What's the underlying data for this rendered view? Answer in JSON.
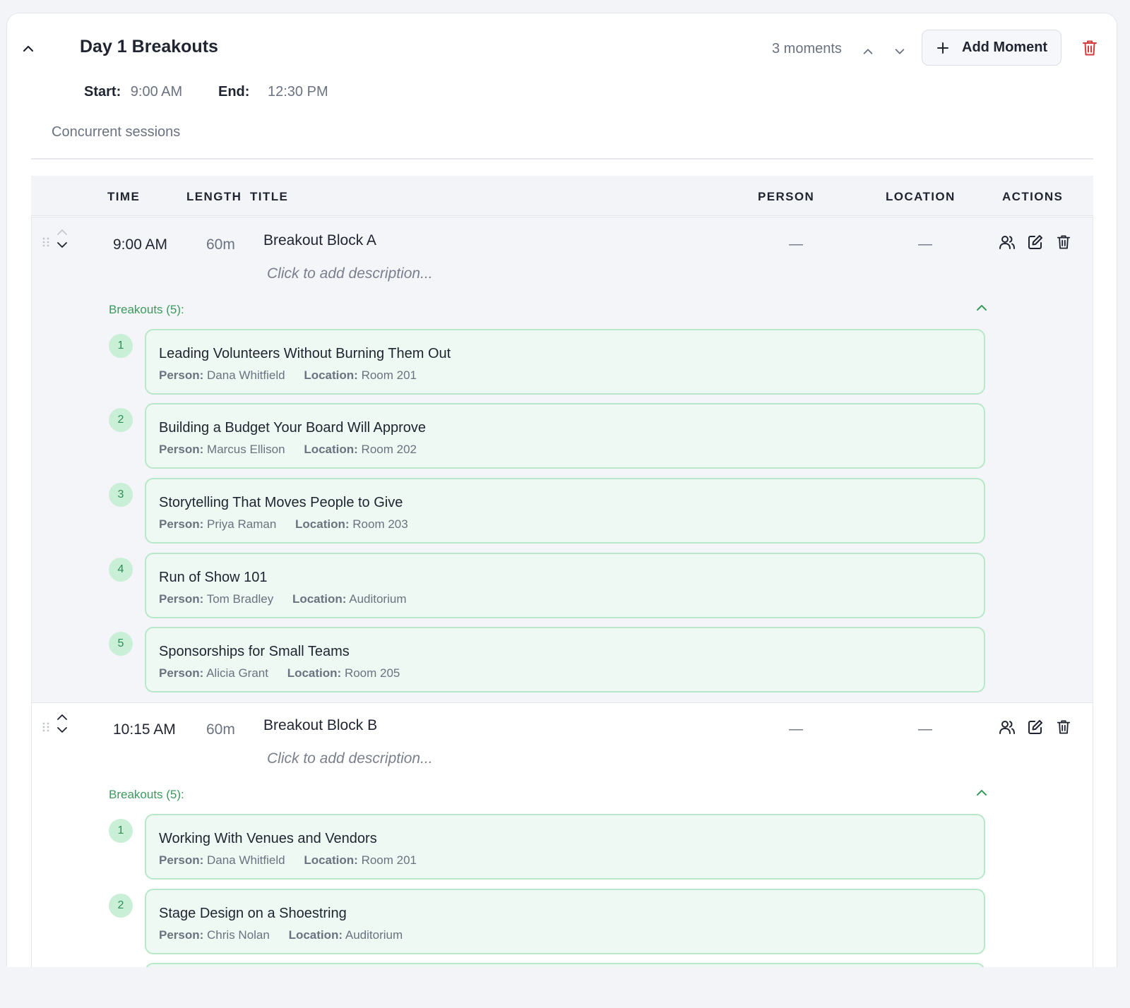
{
  "section": {
    "title": "Day 1 Breakouts",
    "moments_count": "3 moments",
    "add_moment_label": "Add Moment",
    "start_label": "Start:",
    "start_value": "9:00 AM",
    "end_label": "End:",
    "end_value": "12:30 PM",
    "description": "Concurrent sessions"
  },
  "table": {
    "columns": {
      "time": "TIME",
      "length": "LENGTH",
      "title": "TITLE",
      "person": "PERSON",
      "location": "LOCATION",
      "actions": "ACTIONS"
    }
  },
  "moments": [
    {
      "time": "9:00 AM",
      "length": "60m",
      "title": "Breakout Block A",
      "description_placeholder": "Click to add description...",
      "person": "—",
      "location": "—",
      "breakouts_label": "Breakouts (5):",
      "breakouts": [
        {
          "num": "1",
          "title": "Leading Volunteers Without Burning Them Out",
          "person_label": "Person:",
          "person": "Dana Whitfield",
          "location_label": "Location:",
          "location": "Room 201"
        },
        {
          "num": "2",
          "title": "Building a Budget Your Board Will Approve",
          "person_label": "Person:",
          "person": "Marcus Ellison",
          "location_label": "Location:",
          "location": "Room 202"
        },
        {
          "num": "3",
          "title": "Storytelling That Moves People to Give",
          "person_label": "Person:",
          "person": "Priya Raman",
          "location_label": "Location:",
          "location": "Room 203"
        },
        {
          "num": "4",
          "title": "Run of Show 101",
          "person_label": "Person:",
          "person": "Tom Bradley",
          "location_label": "Location:",
          "location": "Auditorium"
        },
        {
          "num": "5",
          "title": "Sponsorships for Small Teams",
          "person_label": "Person:",
          "person": "Alicia Grant",
          "location_label": "Location:",
          "location": "Room 205"
        }
      ]
    },
    {
      "time": "10:15 AM",
      "length": "60m",
      "title": "Breakout Block B",
      "description_placeholder": "Click to add description...",
      "person": "—",
      "location": "—",
      "breakouts_label": "Breakouts (5):",
      "breakouts": [
        {
          "num": "1",
          "title": "Working With Venues and Vendors",
          "person_label": "Person:",
          "person": "Dana Whitfield",
          "location_label": "Location:",
          "location": "Room 201"
        },
        {
          "num": "2",
          "title": "Stage Design on a Shoestring",
          "person_label": "Person:",
          "person": "Chris Nolan",
          "location_label": "Location:",
          "location": "Auditorium"
        }
      ]
    }
  ],
  "colors": {
    "accent_green": "#3a9a5c",
    "breakout_bg": "#edf9f2",
    "breakout_border": "#b8e7c9",
    "danger": "#d63b3b"
  },
  "icons": {
    "collapse": "chevron-up-icon",
    "move_up": "chevron-up-icon",
    "move_down": "chevron-down-icon",
    "add": "plus-icon",
    "delete": "trash-icon",
    "people": "people-icon",
    "edit": "edit-icon",
    "drag": "drag-handle-icon"
  }
}
